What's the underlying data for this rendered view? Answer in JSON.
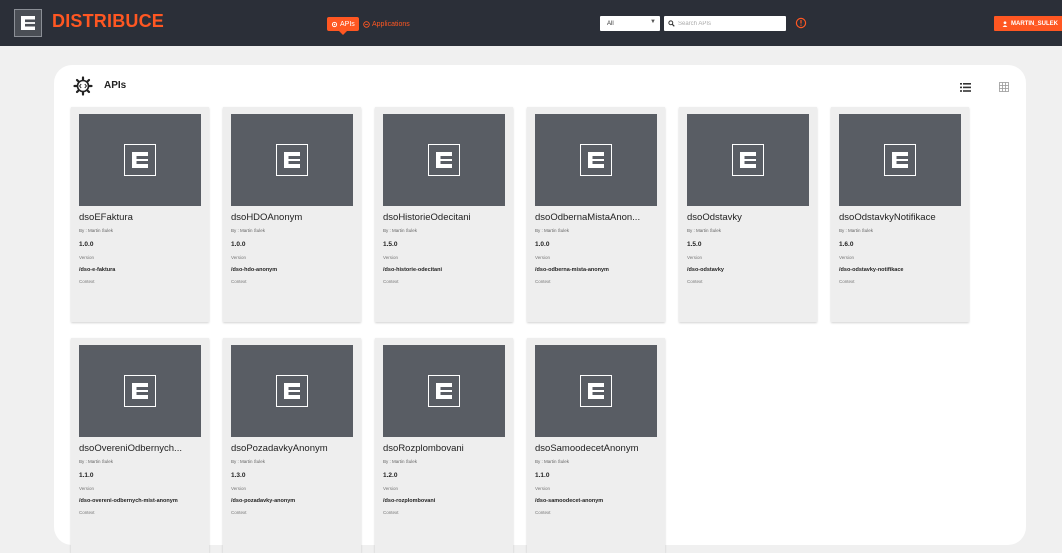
{
  "app": {
    "brand": "DISTRIBUCE",
    "nav": [
      {
        "label": "APIs",
        "active": true,
        "icon": "gear-icon"
      },
      {
        "label": "Applications",
        "active": false,
        "icon": "apps-icon"
      }
    ],
    "filter": {
      "selected": "All"
    },
    "search": {
      "placeholder": "Search APIs"
    },
    "user": {
      "name": "MARTIN_SULEK"
    },
    "accent_color": "#ff5722",
    "topbar_color": "#2b2f38"
  },
  "main": {
    "title": "APIs",
    "version_label": "Version",
    "context_label": "Context",
    "apis": [
      {
        "name": "dsoEFaktura",
        "author": "By : Martin Šulek",
        "version": "1.0.0",
        "context": "/dso-e-faktura"
      },
      {
        "name": "dsoHDOAnonym",
        "author": "By : Martin Šulek",
        "version": "1.0.0",
        "context": "/dso-hdo-anonym"
      },
      {
        "name": "dsoHistorieOdecitani",
        "author": "By : Martin Šulek",
        "version": "1.5.0",
        "context": "/dso-historie-odecitani"
      },
      {
        "name": "dsoOdbernaMistaAnon...",
        "author": "By : Martin Šulek",
        "version": "1.0.0",
        "context": "/dso-odberna-mista-anonym"
      },
      {
        "name": "dsoOdstavky",
        "author": "By : Martin Šulek",
        "version": "1.5.0",
        "context": "/dso-odstavky"
      },
      {
        "name": "dsoOdstavkyNotifikace",
        "author": "By : Martin Šulek",
        "version": "1.6.0",
        "context": "/dso-odstavky-notifikace"
      },
      {
        "name": "dsoOvereniOdbernych...",
        "author": "By : Martin Šulek",
        "version": "1.1.0",
        "context": "/dso-overeni-odbernych-mist-anonym"
      },
      {
        "name": "dsoPozadavkyAnonym",
        "author": "By : Martin Šulek",
        "version": "1.3.0",
        "context": "/dso-pozadavky-anonym"
      },
      {
        "name": "dsoRozplombovani",
        "author": "By : Martin Šulek",
        "version": "1.2.0",
        "context": "/dso-rozplombovani"
      },
      {
        "name": "dsoSamoodecetAnonym",
        "author": "By : Martin Šulek",
        "version": "1.1.0",
        "context": "/dso-samoodecet-anonym"
      }
    ]
  }
}
